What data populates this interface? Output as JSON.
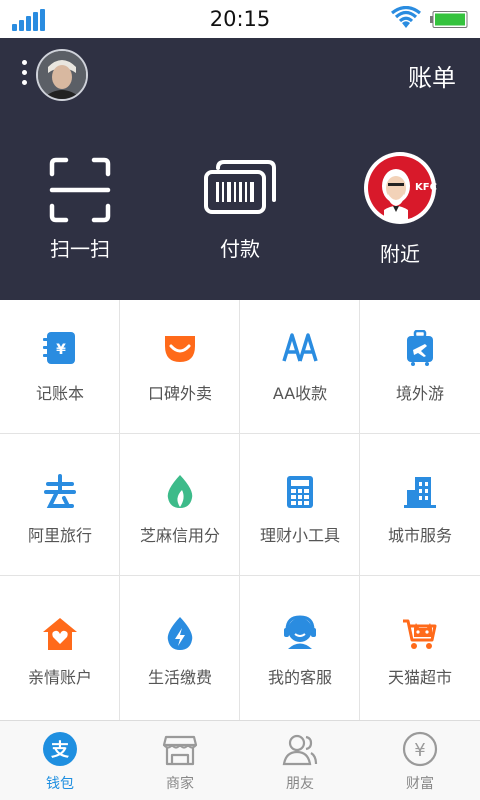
{
  "status_bar": {
    "time": "20:15"
  },
  "header": {
    "bill_label": "账单",
    "menu_icon": "more-vertical-icon",
    "avatar_icon": "avatar"
  },
  "quick_actions": [
    {
      "label": "扫一扫",
      "icon": "scan-icon"
    },
    {
      "label": "付款",
      "icon": "barcode-pay-icon"
    },
    {
      "label": "附近",
      "icon": "kfc-logo-icon"
    }
  ],
  "services": [
    {
      "label": "记账本",
      "icon": "ledger-icon",
      "color": "#2a8ce0"
    },
    {
      "label": "口碑外卖",
      "icon": "koubei-takeout-icon",
      "color": "#ff6a1a"
    },
    {
      "label": "AA收款",
      "icon": "aa-collect-icon",
      "color": "#2a8ce0"
    },
    {
      "label": "境外游",
      "icon": "luggage-icon",
      "color": "#2a8ce0"
    },
    {
      "label": "阿里旅行",
      "icon": "alitrip-icon",
      "color": "#2a8ce0"
    },
    {
      "label": "芝麻信用分",
      "icon": "sesame-credit-icon",
      "color": "#3dbb8a"
    },
    {
      "label": "理财小工具",
      "icon": "calculator-icon",
      "color": "#2a8ce0"
    },
    {
      "label": "城市服务",
      "icon": "city-building-icon",
      "color": "#2a8ce0"
    },
    {
      "label": "亲情账户",
      "icon": "family-home-icon",
      "color": "#ff6a1a"
    },
    {
      "label": "生活缴费",
      "icon": "utility-bill-icon",
      "color": "#2a8ce0"
    },
    {
      "label": "我的客服",
      "icon": "customer-service-icon",
      "color": "#2a8ce0"
    },
    {
      "label": "天猫超市",
      "icon": "tmall-cart-icon",
      "color": "#ff6a1a"
    }
  ],
  "tabbar": [
    {
      "label": "钱包",
      "icon": "wallet-icon",
      "active": true,
      "glyph": "支"
    },
    {
      "label": "商家",
      "icon": "store-icon",
      "active": false
    },
    {
      "label": "朋友",
      "icon": "friends-icon",
      "active": false
    },
    {
      "label": "财富",
      "icon": "wealth-icon",
      "active": false,
      "glyph": "¥"
    }
  ],
  "colors": {
    "header_bg": "#2f3143",
    "accent_blue": "#2a8ce0",
    "accent_orange": "#ff6a1a",
    "accent_green": "#3dbb8a"
  }
}
